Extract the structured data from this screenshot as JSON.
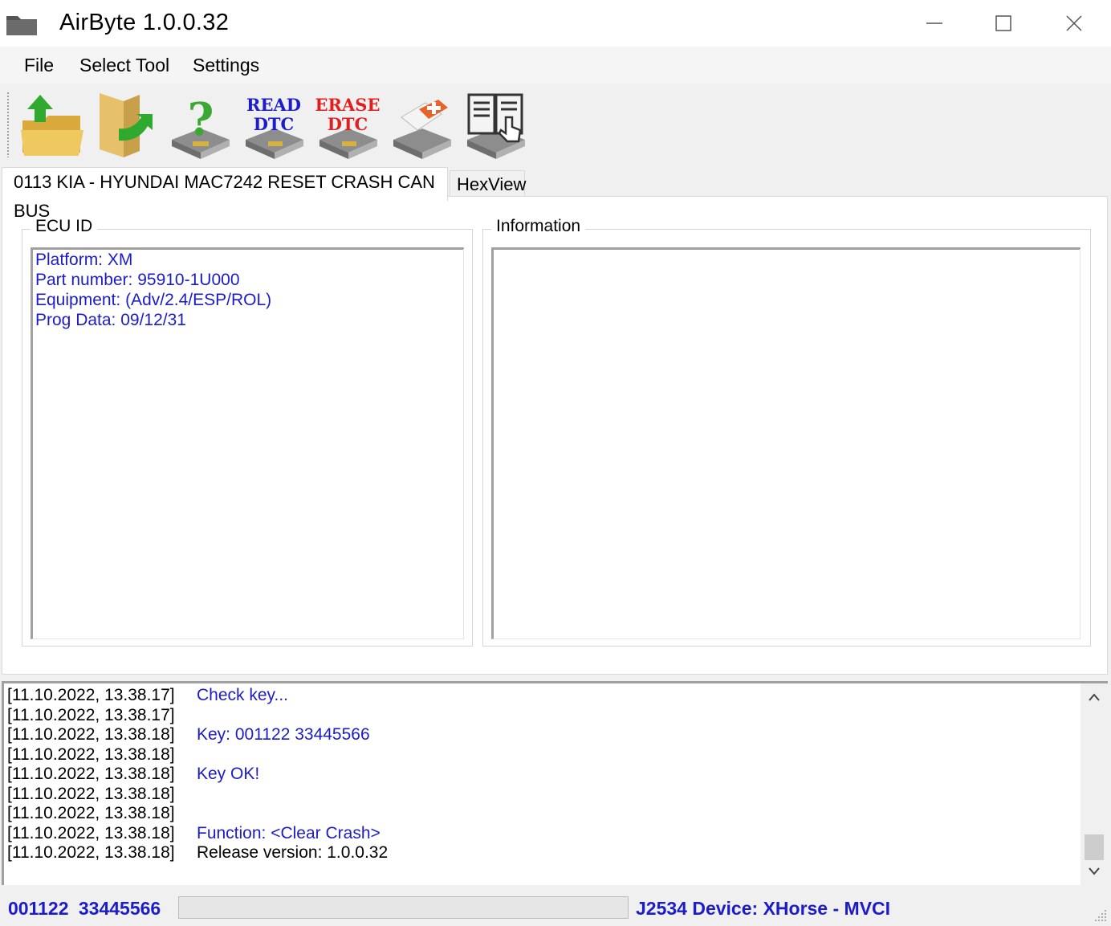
{
  "window": {
    "title": "AirByte  1.0.0.32"
  },
  "menu": {
    "file": "File",
    "select_tool": "Select Tool",
    "settings": "Settings"
  },
  "toolbar": {
    "read_dtc": {
      "line1": "READ",
      "line2": "DTC",
      "color": "#1c1cc8"
    },
    "erase_dtc": {
      "line1": "ERASE",
      "line2": "DTC",
      "color": "#e02020"
    },
    "icons": [
      "open-folder-icon",
      "load-file-icon",
      "help-icon",
      "read-dtc-icon",
      "erase-dtc-icon",
      "first-aid-icon",
      "manual-book-icon"
    ]
  },
  "tabs": [
    {
      "label": "0113 KIA - HYUNDAI MAC7242 RESET CRASH CAN BUS"
    },
    {
      "label": "HexView"
    }
  ],
  "ecu_id": {
    "title": "ECU ID",
    "lines": [
      "Platform: XM",
      "Part number: 95910-1U000",
      "Equipment: (Adv/2.4/ESP/ROL)",
      "Prog Data: 09/12/31"
    ]
  },
  "information": {
    "title": "Information"
  },
  "log": [
    {
      "ts": "[11.10.2022, 13.38.17]",
      "msg": "Check key...",
      "color": "#1c1cc8"
    },
    {
      "ts": "[11.10.2022, 13.38.17]",
      "msg": "",
      "color": "#1c1cc8"
    },
    {
      "ts": "[11.10.2022, 13.38.18]",
      "msg": "Key: 001122  33445566",
      "color": "#1c1cc8"
    },
    {
      "ts": "[11.10.2022, 13.38.18]",
      "msg": "",
      "color": "#1c1cc8"
    },
    {
      "ts": "[11.10.2022, 13.38.18]",
      "msg": "Key OK!",
      "color": "#1c1cc8"
    },
    {
      "ts": "[11.10.2022, 13.38.18]",
      "msg": "",
      "color": "#1c1cc8"
    },
    {
      "ts": "[11.10.2022, 13.38.18]",
      "msg": "",
      "color": "#1c1cc8"
    },
    {
      "ts": "[11.10.2022, 13.38.18]",
      "msg": "Function: <Clear Crash>",
      "color": "#1c1cc8"
    },
    {
      "ts": "[11.10.2022, 13.38.18]",
      "msg": "Release version: 1.0.0.32",
      "color": "#000000"
    }
  ],
  "status": {
    "key": "001122  33445566",
    "device": "J2534 Device: XHorse - MVCI"
  }
}
